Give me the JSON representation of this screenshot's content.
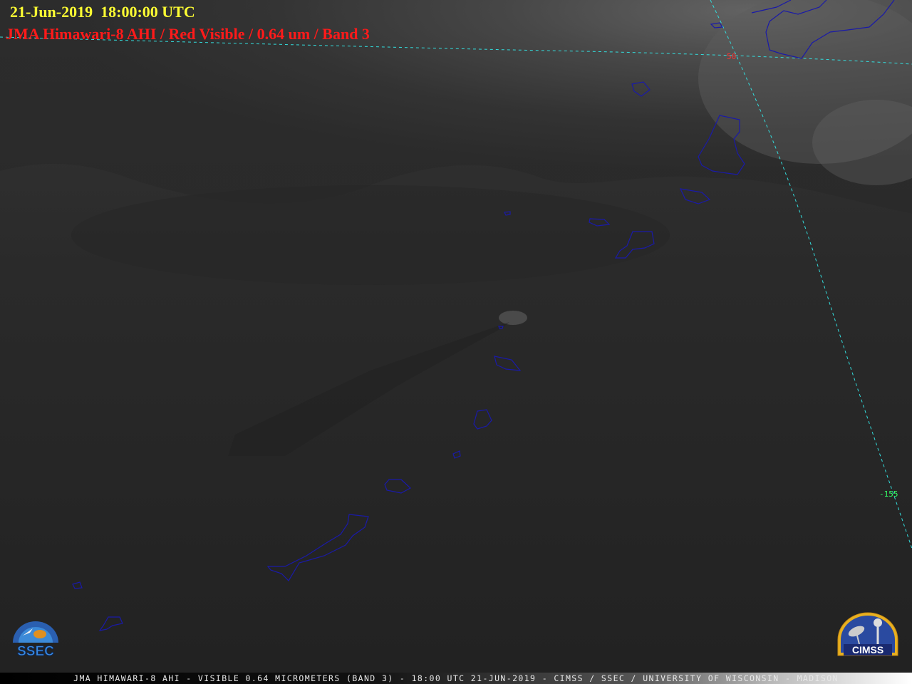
{
  "header": {
    "datetime": "21-Jun-2019  18:00:00 UTC",
    "product": "JMA Himawari-8 AHI / Red Visible / 0.64 um / Band 3"
  },
  "gridlines": {
    "lat_label": "50",
    "lon_label": "-155",
    "color": "#33dddd",
    "lat_label_color": "#ff3333",
    "lon_label_color": "#33ff66"
  },
  "coastline_color": "#1a1aa8",
  "logos": {
    "left": "SSEC",
    "right": "CIMSS"
  },
  "footer": {
    "caption": "JMA HIMAWARI-8 AHI - VISIBLE 0.64 MICROMETERS (BAND 3) - 18:00 UTC 21-JUN-2019 - CIMSS / SSEC / UNIVERSITY OF WISCONSIN - MADISON"
  },
  "colors": {
    "date_text": "#ffff33",
    "product_text": "#ff1a1a"
  }
}
